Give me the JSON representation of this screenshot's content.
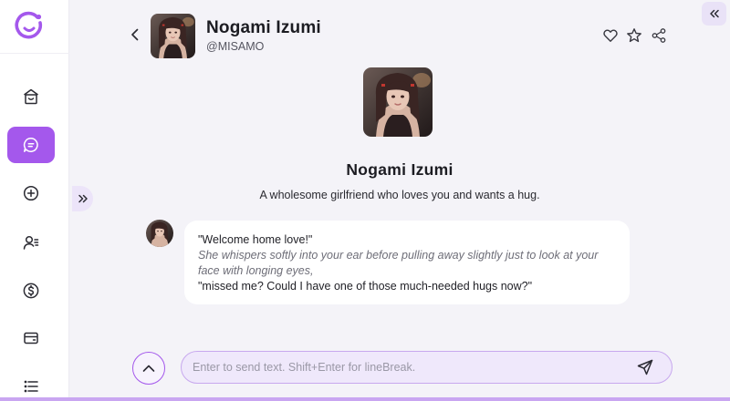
{
  "colors": {
    "accent": "#a458ec",
    "accent_light": "#ece4f9",
    "background": "#f4f3f8",
    "sidebar_bg": "#ffffff"
  },
  "sidebar": {
    "logo_icon": "app-logo-icon",
    "items": [
      {
        "icon": "home-icon",
        "active": false
      },
      {
        "icon": "chat-icon",
        "active": true
      },
      {
        "icon": "add-circle-icon",
        "active": false
      },
      {
        "icon": "user-list-icon",
        "active": false
      },
      {
        "icon": "dollar-icon",
        "active": false
      },
      {
        "icon": "wallet-icon",
        "active": false
      },
      {
        "icon": "list-icon",
        "active": false
      }
    ]
  },
  "header": {
    "name": "Nogami Izumi",
    "handle": "@MISAMO"
  },
  "profile": {
    "name": "Nogami Izumi",
    "description": "A wholesome girlfriend who loves you and wants a hug."
  },
  "message": {
    "line1": "\"Welcome home love!\"",
    "line2": "She whispers softly into your ear before pulling away slightly just to look at your face with longing eyes,",
    "line3": "\"missed me? Could I have one of those much-needed hugs now?\""
  },
  "composer": {
    "placeholder": "Enter to send text. Shift+Enter for lineBreak.",
    "value": ""
  }
}
